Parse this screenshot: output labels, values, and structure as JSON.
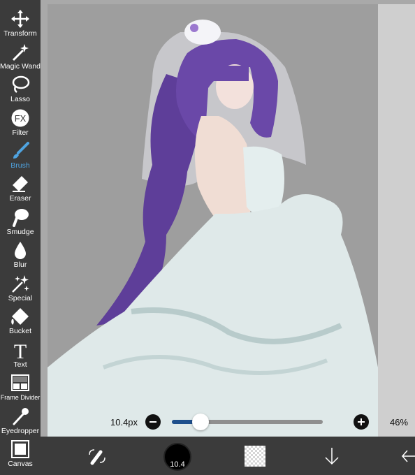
{
  "tools": [
    {
      "id": "transform",
      "label": "Transform",
      "icon": "move-arrows-icon"
    },
    {
      "id": "magic-wand",
      "label": "Magic Wand",
      "icon": "magic-wand-icon"
    },
    {
      "id": "lasso",
      "label": "Lasso",
      "icon": "lasso-icon"
    },
    {
      "id": "filter",
      "label": "Filter",
      "icon": "fx-icon",
      "icon_text": "FX"
    },
    {
      "id": "brush",
      "label": "Brush",
      "icon": "brush-icon",
      "active": true
    },
    {
      "id": "eraser",
      "label": "Eraser",
      "icon": "eraser-icon"
    },
    {
      "id": "smudge",
      "label": "Smudge",
      "icon": "smudge-icon"
    },
    {
      "id": "blur",
      "label": "Blur",
      "icon": "blur-drop-icon"
    },
    {
      "id": "special",
      "label": "Special",
      "icon": "sparkle-icon"
    },
    {
      "id": "bucket",
      "label": "Bucket",
      "icon": "bucket-icon"
    },
    {
      "id": "text",
      "label": "Text",
      "icon": "text-t-icon",
      "icon_text": "T"
    },
    {
      "id": "frame-divider",
      "label": "Frame Divider",
      "icon": "frame-divider-icon"
    },
    {
      "id": "eyedropper",
      "label": "Eyedropper",
      "icon": "eyedropper-icon"
    },
    {
      "id": "canvas",
      "label": "Canvas",
      "icon": "canvas-icon"
    }
  ],
  "brush": {
    "size_label": "10.4px",
    "size_slider_fraction": 0.19,
    "opacity_label": "46%",
    "minus_icon": "minus-icon",
    "plus_icon": "plus-icon"
  },
  "bottombar": {
    "color_swap_icon": "swap-icon",
    "brush_button_label": "10.4",
    "layer_icon": "layer-thumbnail-icon",
    "down_icon": "arrow-down-icon",
    "back_icon": "arrow-left-icon"
  },
  "colors": {
    "toolbar_bg": "#3b3b3b",
    "active_tool": "#4fa3e0",
    "slider_fill": "#1e4f8c",
    "hair": "#5e3e99",
    "dress": "#dfe9e9"
  }
}
